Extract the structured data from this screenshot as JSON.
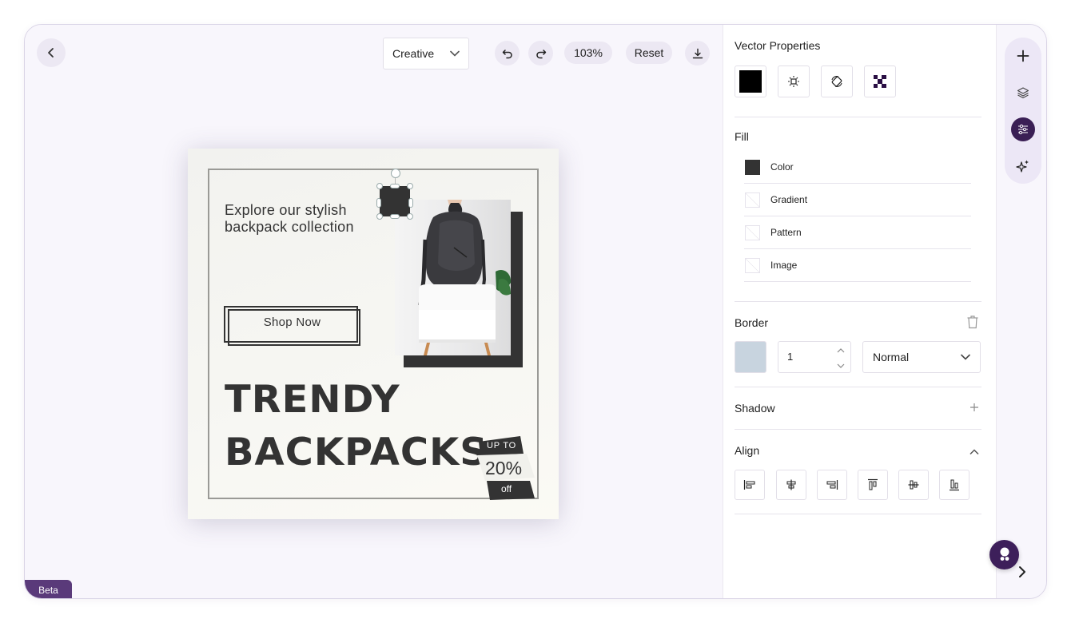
{
  "toolbar": {
    "mode": "Creative",
    "zoom": "103%",
    "reset_label": "Reset"
  },
  "design": {
    "headline": "Explore our stylish backpack collection",
    "cta": "Shop Now",
    "big_line_1": "TRENDY",
    "big_line_2": "BACKPACKS",
    "badge_top": "UP TO",
    "badge_value": "20%",
    "badge_bottom": "off"
  },
  "properties": {
    "title": "Vector Properties",
    "fill_label": "Fill",
    "fill_options": [
      "Color",
      "Gradient",
      "Pattern",
      "Image"
    ],
    "fill_color": "#333333",
    "border_label": "Border",
    "border_width": "1",
    "border_style": "Normal",
    "border_color": "#c8d4df",
    "shadow_label": "Shadow",
    "align_label": "Align"
  },
  "beta_label": "Beta",
  "colors": {
    "accent": "#3a1f55",
    "rail_bg": "#ece7f6",
    "canvas_bg": "#f8f6fc"
  },
  "icons": {
    "back": "chevron-left-icon",
    "undo": "undo-icon",
    "redo": "redo-icon",
    "download": "download-icon",
    "rail": [
      "plus-icon",
      "layers-icon",
      "sliders-icon",
      "sparkle-icon"
    ]
  }
}
